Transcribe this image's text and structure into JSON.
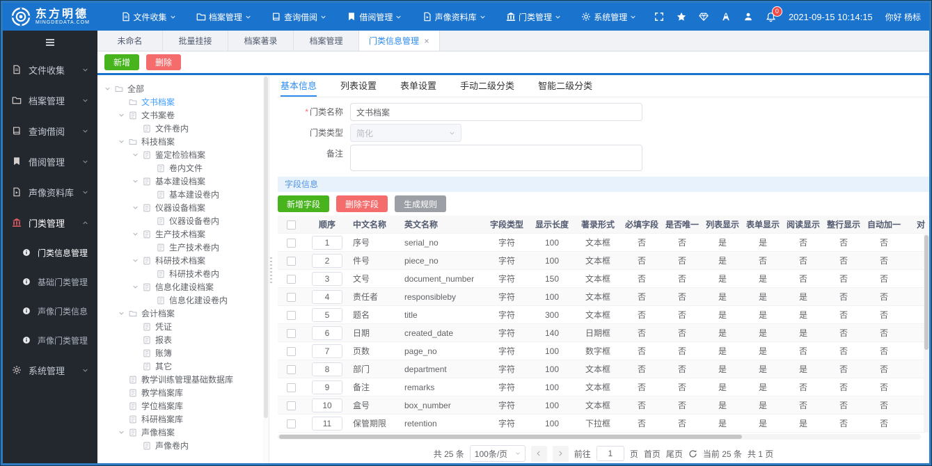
{
  "topbar": {
    "logo": {
      "title": "东方明德",
      "subtitle": "MINGDEDATA.COM"
    },
    "nav": [
      {
        "label": "文件收集",
        "icon": "document-icon"
      },
      {
        "label": "档案管理",
        "icon": "folder-icon"
      },
      {
        "label": "查询借阅",
        "icon": "book-icon"
      },
      {
        "label": "借阅管理",
        "icon": "bookmark-icon"
      },
      {
        "label": "声像资料库",
        "icon": "media-file-icon"
      },
      {
        "label": "门类管理",
        "icon": "bank-icon"
      },
      {
        "label": "系统管理",
        "icon": "gears-icon"
      }
    ],
    "quick_icons": [
      "fullscreen-icon",
      "star-icon",
      "gem-icon",
      "font-icon",
      "user-icon"
    ],
    "notification_count": "0",
    "datetime": "2021-09-15 10:14:15",
    "greeting": "你好 杨标"
  },
  "sidebar": {
    "items": [
      {
        "label": "文件收集",
        "icon": "document-icon",
        "expanded": false
      },
      {
        "label": "档案管理",
        "icon": "folder-icon",
        "expanded": false
      },
      {
        "label": "查询借阅",
        "icon": "book-icon",
        "expanded": false
      },
      {
        "label": "借阅管理",
        "icon": "bookmark-icon",
        "expanded": false
      },
      {
        "label": "声像资料库",
        "icon": "media-file-icon",
        "expanded": false
      },
      {
        "label": "门类管理",
        "icon": "bank-icon",
        "expanded": true,
        "active": true,
        "children": [
          {
            "label": "门类信息管理",
            "icon": "info-circle-icon",
            "active": true
          },
          {
            "label": "基础门类管理",
            "icon": "info-circle-icon",
            "active": false
          },
          {
            "label": "声像门类信息",
            "icon": "info-circle-icon",
            "active": false
          },
          {
            "label": "声像门类管理",
            "icon": "info-circle-icon",
            "active": false
          }
        ]
      },
      {
        "label": "系统管理",
        "icon": "gears-icon",
        "expanded": false
      }
    ]
  },
  "tabstrip": {
    "tabs": [
      {
        "label": "未命名",
        "active": false,
        "closable": false
      },
      {
        "label": "批量挂接",
        "active": false,
        "closable": false
      },
      {
        "label": "档案著录",
        "active": false,
        "closable": false
      },
      {
        "label": "档案管理",
        "active": false,
        "closable": false
      },
      {
        "label": "门类信息管理",
        "active": true,
        "closable": true
      }
    ]
  },
  "toolbar": {
    "add_label": "新增",
    "delete_label": "删除"
  },
  "tree": {
    "items": [
      {
        "label": "全部",
        "level": 0,
        "caret": true,
        "icon": "folder",
        "selected": false
      },
      {
        "label": "文书档案",
        "level": 1,
        "caret": false,
        "icon": "folder",
        "selected": true
      },
      {
        "label": "文书案卷",
        "level": 1,
        "caret": true,
        "icon": "file",
        "selected": false
      },
      {
        "label": "文件卷内",
        "level": 2,
        "caret": false,
        "icon": "file",
        "selected": false
      },
      {
        "label": "科技档案",
        "level": 1,
        "caret": true,
        "icon": "folder",
        "selected": false
      },
      {
        "label": "鉴定检验档案",
        "level": 2,
        "caret": true,
        "icon": "file",
        "selected": false
      },
      {
        "label": "卷内文件",
        "level": 3,
        "caret": false,
        "icon": "file",
        "selected": false
      },
      {
        "label": "基本建设档案",
        "level": 2,
        "caret": true,
        "icon": "file",
        "selected": false
      },
      {
        "label": "基本建设卷内",
        "level": 3,
        "caret": false,
        "icon": "file",
        "selected": false
      },
      {
        "label": "仪器设备档案",
        "level": 2,
        "caret": true,
        "icon": "file",
        "selected": false
      },
      {
        "label": "仪器设备卷内",
        "level": 3,
        "caret": false,
        "icon": "file",
        "selected": false
      },
      {
        "label": "生产技术档案",
        "level": 2,
        "caret": true,
        "icon": "file",
        "selected": false
      },
      {
        "label": "生产技术卷内",
        "level": 3,
        "caret": false,
        "icon": "file",
        "selected": false
      },
      {
        "label": "科研技术档案",
        "level": 2,
        "caret": true,
        "icon": "file",
        "selected": false
      },
      {
        "label": "科研技术卷内",
        "level": 3,
        "caret": false,
        "icon": "file",
        "selected": false
      },
      {
        "label": "信息化建设档案",
        "level": 2,
        "caret": true,
        "icon": "file",
        "selected": false
      },
      {
        "label": "信息化建设卷内",
        "level": 3,
        "caret": false,
        "icon": "file",
        "selected": false
      },
      {
        "label": "会计档案",
        "level": 1,
        "caret": true,
        "icon": "folder",
        "selected": false
      },
      {
        "label": "凭证",
        "level": 2,
        "caret": false,
        "icon": "file",
        "selected": false
      },
      {
        "label": "报表",
        "level": 2,
        "caret": false,
        "icon": "file",
        "selected": false
      },
      {
        "label": "账簿",
        "level": 2,
        "caret": false,
        "icon": "file",
        "selected": false
      },
      {
        "label": "其它",
        "level": 2,
        "caret": false,
        "icon": "file",
        "selected": false
      },
      {
        "label": "教学训练管理基础数据库",
        "level": 1,
        "caret": false,
        "icon": "file",
        "selected": false
      },
      {
        "label": "教学档案库",
        "level": 1,
        "caret": false,
        "icon": "file",
        "selected": false
      },
      {
        "label": "学位档案库",
        "level": 1,
        "caret": false,
        "icon": "file",
        "selected": false
      },
      {
        "label": "科研档案库",
        "level": 1,
        "caret": false,
        "icon": "file",
        "selected": false
      },
      {
        "label": "声像档案",
        "level": 1,
        "caret": true,
        "icon": "file",
        "selected": false
      },
      {
        "label": "声像卷内",
        "level": 2,
        "caret": false,
        "icon": "file",
        "selected": false
      }
    ]
  },
  "detail": {
    "tabs": [
      "基本信息",
      "列表设置",
      "表单设置",
      "手动二级分类",
      "智能二级分类"
    ],
    "active_tab": "基本信息",
    "form": {
      "name_label": "门类名称",
      "name_value": "文书档案",
      "type_label": "门类类型",
      "type_value": "简化",
      "remark_label": "备注",
      "remark_value": ""
    },
    "section_title": "字段信息",
    "buttons": {
      "add_field": "新增字段",
      "delete_field": "删除字段",
      "generate_rule": "生成规则"
    },
    "table": {
      "columns": [
        "顺序",
        "中文名称",
        "英文名称",
        "字段类型",
        "显示长度",
        "著录形式",
        "必填字段",
        "是否唯一",
        "列表显示",
        "表单显示",
        "阅读显示",
        "整行显示",
        "自动加一",
        "对"
      ],
      "rows": [
        {
          "order": "1",
          "cn": "序号",
          "en": "serial_no",
          "type": "字符",
          "length": "100",
          "entry": "文本框",
          "flags": [
            "否",
            "否",
            "是",
            "是",
            "否",
            "否",
            "否"
          ]
        },
        {
          "order": "2",
          "cn": "件号",
          "en": "piece_no",
          "type": "字符",
          "length": "100",
          "entry": "文本框",
          "flags": [
            "否",
            "否",
            "是",
            "否",
            "否",
            "否",
            "否"
          ]
        },
        {
          "order": "3",
          "cn": "文号",
          "en": "document_number",
          "type": "字符",
          "length": "150",
          "entry": "文本框",
          "flags": [
            "否",
            "否",
            "是",
            "是",
            "否",
            "否",
            "否"
          ]
        },
        {
          "order": "4",
          "cn": "责任者",
          "en": "responsibleby",
          "type": "字符",
          "length": "100",
          "entry": "文本框",
          "flags": [
            "否",
            "否",
            "是",
            "是",
            "是",
            "否",
            "否"
          ]
        },
        {
          "order": "5",
          "cn": "题名",
          "en": "title",
          "type": "字符",
          "length": "300",
          "entry": "文本框",
          "flags": [
            "否",
            "否",
            "是",
            "是",
            "是",
            "否",
            "否"
          ]
        },
        {
          "order": "6",
          "cn": "日期",
          "en": "created_date",
          "type": "字符",
          "length": "140",
          "entry": "日期框",
          "flags": [
            "否",
            "否",
            "是",
            "是",
            "是",
            "否",
            "否"
          ]
        },
        {
          "order": "7",
          "cn": "页数",
          "en": "page_no",
          "type": "字符",
          "length": "100",
          "entry": "数字框",
          "flags": [
            "否",
            "否",
            "是",
            "是",
            "否",
            "否",
            "否"
          ]
        },
        {
          "order": "8",
          "cn": "部门",
          "en": "department",
          "type": "字符",
          "length": "100",
          "entry": "文本框",
          "flags": [
            "否",
            "否",
            "是",
            "是",
            "是",
            "否",
            "否"
          ]
        },
        {
          "order": "9",
          "cn": "备注",
          "en": "remarks",
          "type": "字符",
          "length": "100",
          "entry": "文本框",
          "flags": [
            "否",
            "否",
            "是",
            "是",
            "否",
            "否",
            "否"
          ]
        },
        {
          "order": "10",
          "cn": "盒号",
          "en": "box_number",
          "type": "字符",
          "length": "100",
          "entry": "文本框",
          "flags": [
            "否",
            "否",
            "是",
            "是",
            "否",
            "否",
            "否"
          ]
        },
        {
          "order": "11",
          "cn": "保管期限",
          "en": "retention",
          "type": "字符",
          "length": "100",
          "entry": "下拉框",
          "flags": [
            "否",
            "否",
            "是",
            "是",
            "是",
            "否",
            "否"
          ]
        }
      ]
    },
    "pagination": {
      "total": "共 25 条",
      "page_size": "100条/页",
      "goto_label": "前往",
      "page_value": "1",
      "page_suffix": "页",
      "first": "首页",
      "last": "尾页",
      "current": "当前 25 条",
      "pages": "共 1 页"
    }
  },
  "colors": {
    "topbar_blue": "#1a73cd",
    "sidebar_dark": "#23272e",
    "accent_blue": "#2d8cf0",
    "green_button": "#47b41e",
    "red_button": "#f56c6c",
    "gray_button": "#9c9fa5",
    "badge_red": "#ef4a4a",
    "section_bg": "#e8f2fd"
  }
}
